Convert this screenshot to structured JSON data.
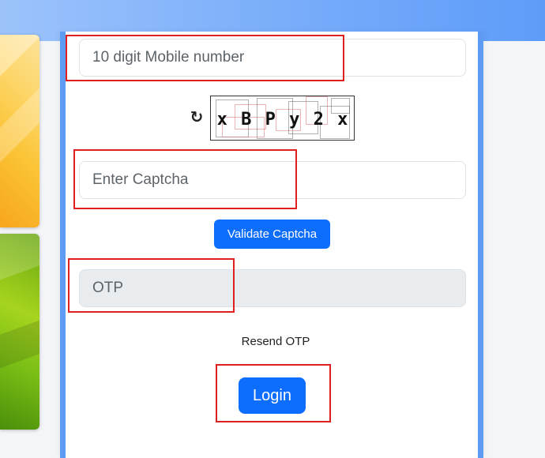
{
  "form": {
    "mobile_placeholder": "10 digit Mobile number",
    "captcha_code": "x B P y 2 x",
    "captcha_placeholder": "Enter Captcha",
    "validate_label": "Validate Captcha",
    "otp_placeholder": "OTP",
    "resend_label": "Resend OTP",
    "login_label": "Login"
  },
  "icons": {
    "refresh": "refresh-icon"
  },
  "colors": {
    "primary_button": "#0d6efd",
    "panel_border": "#5e9bf2",
    "header_gradient_end": "#5d9cf9",
    "highlight_box": "#e01f1f",
    "disabled_field": "#e9ecef"
  }
}
